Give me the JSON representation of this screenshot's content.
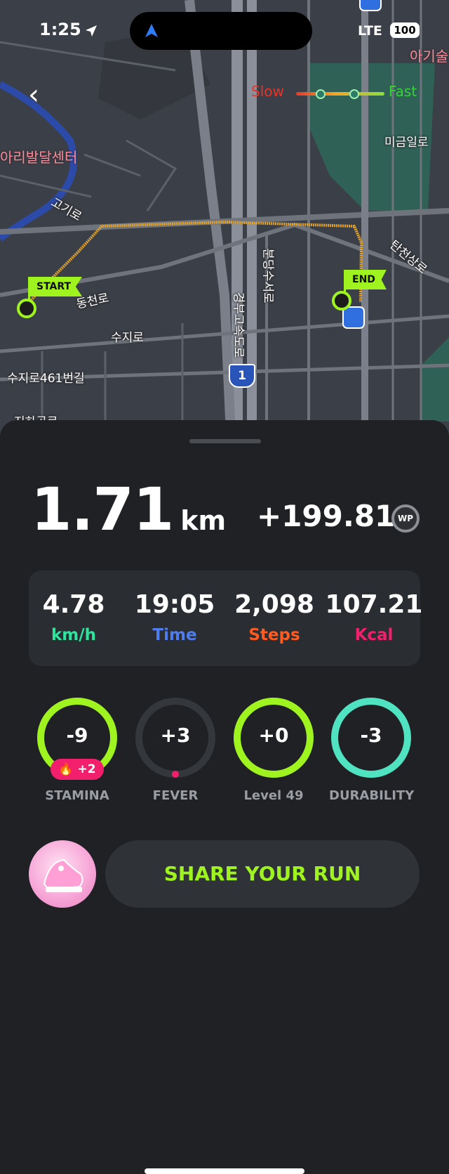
{
  "status_bar": {
    "time": "1:25",
    "network": "LTE",
    "battery": "100"
  },
  "map": {
    "legend": {
      "slow": "Slow",
      "fast": "Fast"
    },
    "start_flag": "START",
    "end_flag": "END",
    "labels": [
      "아리발달센터",
      "아기술",
      "미금일로",
      "고기로",
      "탄천상로",
      "동천로",
      "분당수서로",
      "경부고속도로",
      "수지로",
      "수지로461번길",
      "1",
      "지하공로"
    ]
  },
  "summary": {
    "distance": "1.71",
    "distance_unit": "km",
    "points": "+199.81",
    "points_badge": "WP"
  },
  "stats": [
    {
      "value": "4.78",
      "label": "km/h",
      "color": "#2ee59d"
    },
    {
      "value": "19:05",
      "label": "Time",
      "color": "#4f7df0"
    },
    {
      "value": "2,098",
      "label": "Steps",
      "color": "#ff5a1f"
    },
    {
      "value": "107.21",
      "label": "Kcal",
      "color": "#f2206c"
    }
  ],
  "rings": [
    {
      "value": "-9",
      "label": "STAMINA",
      "color": "#9ff41f",
      "level": 1.0,
      "bonus": "🔥 +2"
    },
    {
      "value": "+3",
      "label": "FEVER",
      "color": "#f2206c",
      "level": 0.0
    },
    {
      "value": "+0",
      "label": "Level 49",
      "color": "#9ff41f",
      "level": 1.0
    },
    {
      "value": "-3",
      "label": "DURABILITY",
      "color": "#4fe3c1",
      "level": 1.0
    }
  ],
  "share_button": "SHARE YOUR RUN"
}
